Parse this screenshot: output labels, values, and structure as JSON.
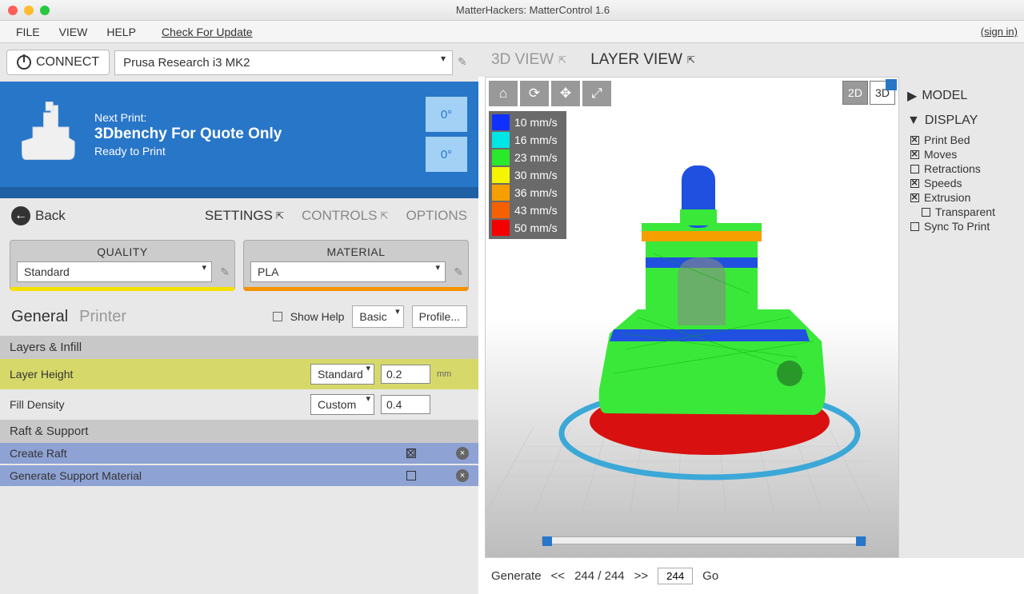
{
  "window": {
    "title": "MatterHackers: MatterControl 1.6"
  },
  "menubar": {
    "items": [
      "FILE",
      "VIEW",
      "HELP"
    ],
    "update": "Check For Update",
    "signin": "(sign in)"
  },
  "connect": {
    "button": "CONNECT",
    "printer": "Prusa Research i3 MK2"
  },
  "print": {
    "next_label": "Next Print:",
    "name": "3Dbenchy For Quote Only",
    "status": "Ready to Print",
    "temp1": "0°",
    "temp2": "0°"
  },
  "nav": {
    "back": "Back",
    "tabs": {
      "settings": "SETTINGS",
      "controls": "CONTROLS",
      "options": "OPTIONS"
    }
  },
  "quality": {
    "header": "QUALITY",
    "value": "Standard"
  },
  "material": {
    "header": "MATERIAL",
    "value": "PLA"
  },
  "settings_tabs": {
    "general": "General",
    "printer": "Printer",
    "show_help": "Show Help",
    "level": "Basic",
    "profile": "Profile..."
  },
  "sections": {
    "layers": {
      "header": "Layers & Infill",
      "layer_height": {
        "label": "Layer Height",
        "preset": "Standard",
        "value": "0.2",
        "unit": "mm"
      },
      "fill_density": {
        "label": "Fill Density",
        "preset": "Custom",
        "value": "0.4",
        "unit": ""
      }
    },
    "raft": {
      "header": "Raft & Support",
      "create_raft": "Create Raft",
      "gen_support": "Generate Support Material"
    }
  },
  "views": {
    "threed": "3D VIEW",
    "layer": "LAYER VIEW",
    "mode2d": "2D",
    "mode3d": "3D"
  },
  "legend": [
    {
      "color": "#1030ff",
      "label": "10 mm/s"
    },
    {
      "color": "#00e5e5",
      "label": "16 mm/s"
    },
    {
      "color": "#2ae82a",
      "label": "23 mm/s"
    },
    {
      "color": "#f5f500",
      "label": "30 mm/s"
    },
    {
      "color": "#f5a000",
      "label": "36 mm/s"
    },
    {
      "color": "#f56000",
      "label": "43 mm/s"
    },
    {
      "color": "#f50000",
      "label": "50 mm/s"
    }
  ],
  "right_panel": {
    "model": "MODEL",
    "display": "DISPLAY",
    "items": [
      {
        "label": "Print Bed",
        "on": true
      },
      {
        "label": "Moves",
        "on": true
      },
      {
        "label": "Retractions",
        "on": false
      },
      {
        "label": "Speeds",
        "on": true
      },
      {
        "label": "Extrusion",
        "on": true
      },
      {
        "label": "Transparent",
        "on": false,
        "indent": true
      },
      {
        "label": "Sync To Print",
        "on": false
      }
    ]
  },
  "generate": {
    "label": "Generate",
    "prev": "<<",
    "count": "244 / 244",
    "next": ">>",
    "input": "244",
    "go": "Go"
  }
}
